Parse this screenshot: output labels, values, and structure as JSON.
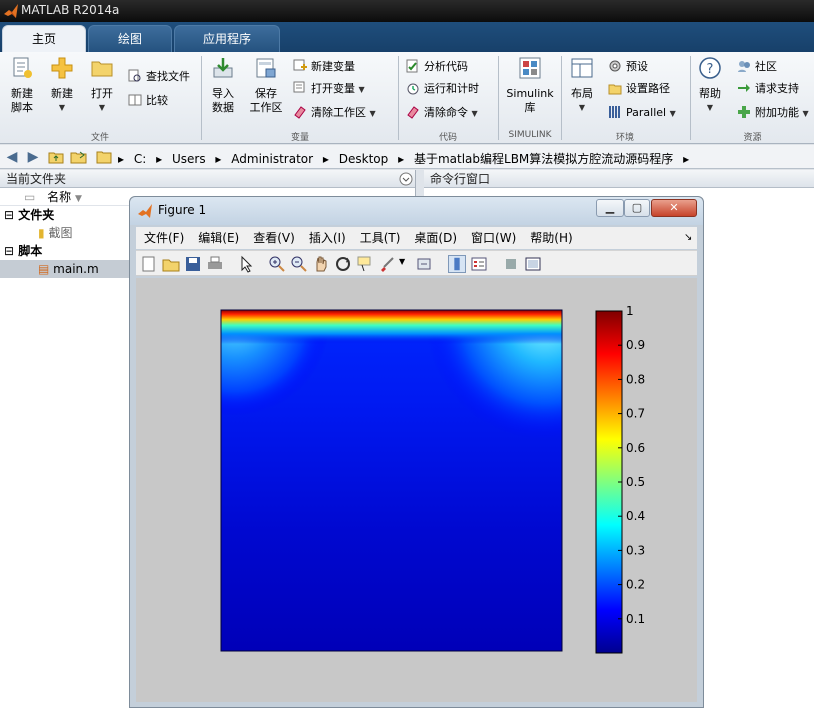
{
  "app": {
    "title": "MATLAB R2014a"
  },
  "tabs": [
    {
      "label": "主页",
      "active": true
    },
    {
      "label": "绘图",
      "active": false
    },
    {
      "label": "应用程序",
      "active": false
    }
  ],
  "ribbon": {
    "file": {
      "new_script": "新建\n脚本",
      "new": "新建",
      "open": "打开",
      "find_files": "查找文件",
      "compare": "比较",
      "group": "文件"
    },
    "variable": {
      "import": "导入\n数据",
      "save_ws": "保存\n工作区",
      "new_var": "新建变量",
      "open_var": "打开变量",
      "clear_ws": "清除工作区",
      "group": "变量"
    },
    "code": {
      "analyze": "分析代码",
      "run_time": "运行和计时",
      "clear_cmd": "清除命令",
      "group": "代码"
    },
    "simulink": {
      "label": "Simulink\n库",
      "group": "SIMULINK"
    },
    "env": {
      "layout": "布局",
      "prefs": "预设",
      "set_path": "设置路径",
      "parallel": "Parallel",
      "group": "环境"
    },
    "resources": {
      "help": "帮助",
      "community": "社区",
      "support": "请求支持",
      "addons": "附加功能",
      "group": "资源"
    }
  },
  "address": {
    "crumbs": [
      "C:",
      "Users",
      "Administrator",
      "Desktop",
      "基于matlab编程LBM算法模拟方腔流动源码程序"
    ]
  },
  "current_folder": {
    "header": "当前文件夹",
    "col_name": "名称",
    "sections": [
      {
        "label": "文件夹",
        "items": [
          "截图"
        ]
      },
      {
        "label": "脚本",
        "items": [
          "main.m"
        ]
      }
    ]
  },
  "command_window": {
    "header": "命令行窗口"
  },
  "figure": {
    "title": "Figure 1",
    "menu": [
      "文件(F)",
      "编辑(E)",
      "查看(V)",
      "插入(I)",
      "工具(T)",
      "桌面(D)",
      "窗口(W)",
      "帮助(H)"
    ],
    "colorbar_ticks": [
      "1",
      "0.9",
      "0.8",
      "0.7",
      "0.6",
      "0.5",
      "0.4",
      "0.3",
      "0.2",
      "0.1"
    ]
  },
  "chart_data": {
    "type": "heatmap",
    "title": "",
    "colormap": "jet",
    "clim": [
      0,
      1
    ],
    "colorbar_ticks": [
      1,
      0.9,
      0.8,
      0.7,
      0.6,
      0.5,
      0.4,
      0.3,
      0.2,
      0.1
    ],
    "description_of_field": "lid-driven cavity velocity magnitude: max (1) at top lid, corner vortices near top-left and top-right, near 0 elsewhere",
    "grid": false
  },
  "colors": {
    "ribbon_bg": "#eef2f7",
    "tab_blue": "#25527f",
    "accent": "#3d6d9c"
  }
}
